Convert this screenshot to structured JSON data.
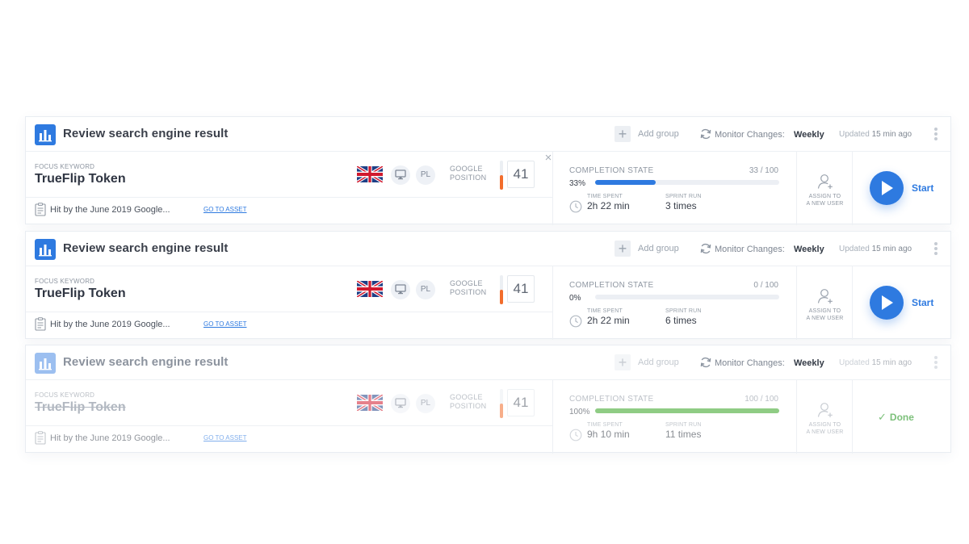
{
  "cards": [
    {
      "title": "Review search engine result",
      "add_group": "Add group",
      "monitor_label": "Monitor Changes:",
      "monitor_value": "Weekly",
      "updated_prefix": "Updated",
      "updated_time": "15 min ago",
      "focus_label": "Focus Keyword",
      "keyword": "TrueFlip Token",
      "lang": "PL",
      "google_pos_line1": "Google",
      "google_pos_line2": "Position",
      "position": "41",
      "position_level": 0.5,
      "close": "×",
      "note": "Hit by the June 2019 Google...",
      "asset_link": "GO TO ASSET",
      "completion_label": "Completion State",
      "completion_count": "33 / 100",
      "completion_pct_label": "33%",
      "completion_fraction": 0.33,
      "completion_color": "#2e7ae0",
      "time_spent_label": "Time Spent",
      "time_spent": "2h 22 min",
      "sprint_run_label": "Sprint Run",
      "sprint_run": "3 times",
      "assign_line1": "Assign to",
      "assign_line2": "a new user",
      "action": "start",
      "action_label": "Start",
      "faded": false
    },
    {
      "title": "Review search engine result",
      "add_group": "Add group",
      "monitor_label": "Monitor Changes:",
      "monitor_value": "Weekly",
      "updated_prefix": "Updated",
      "updated_time": "15 min ago",
      "focus_label": "Focus Keyword",
      "keyword": "TrueFlip Token",
      "lang": "PL",
      "google_pos_line1": "Google",
      "google_pos_line2": "Position",
      "position": "41",
      "position_level": 0.5,
      "close": "",
      "note": "Hit by the June 2019 Google...",
      "asset_link": "GO TO ASSET",
      "completion_label": "Completion State",
      "completion_count": "0 / 100",
      "completion_pct_label": "0%",
      "completion_fraction": 0,
      "completion_color": "#2e7ae0",
      "time_spent_label": "Time Spent",
      "time_spent": "2h 22 min",
      "sprint_run_label": "Sprint Run",
      "sprint_run": "6 times",
      "assign_line1": "Assign to",
      "assign_line2": "a new user",
      "action": "start",
      "action_label": "Start",
      "faded": false
    },
    {
      "title": "Review search engine result",
      "add_group": "Add group",
      "monitor_label": "Monitor Changes:",
      "monitor_value": "Weekly",
      "updated_prefix": "Updated",
      "updated_time": "15 min ago",
      "focus_label": "Focus Keyword",
      "keyword": "TrueFlip Token",
      "lang": "PL",
      "google_pos_line1": "Google",
      "google_pos_line2": "Position",
      "position": "41",
      "position_level": 0.5,
      "close": "",
      "note": "Hit by the June 2019 Google...",
      "asset_link": "GO TO ASSET",
      "completion_label": "Completion State",
      "completion_count": "100 / 100",
      "completion_pct_label": "100%",
      "completion_fraction": 1,
      "completion_color": "#8fcc84",
      "time_spent_label": "Time Spent",
      "time_spent": "9h 10 min",
      "sprint_run_label": "Sprint Run",
      "sprint_run": "11 times",
      "assign_line1": "Assign to",
      "assign_line2": "a new user",
      "action": "done",
      "action_label": "Done",
      "faded": true
    }
  ],
  "icons": {
    "logo": "bar-chart-icon",
    "add_group": "plus-icon",
    "monitor": "sync-icon",
    "more": "more-vertical-icon",
    "flag": "uk-flag-icon",
    "device": "desktop-icon",
    "close": "close-icon",
    "note": "clipboard-icon",
    "time": "clock-icon",
    "assign": "add-user-icon",
    "start": "play-icon",
    "done": "check-icon"
  }
}
